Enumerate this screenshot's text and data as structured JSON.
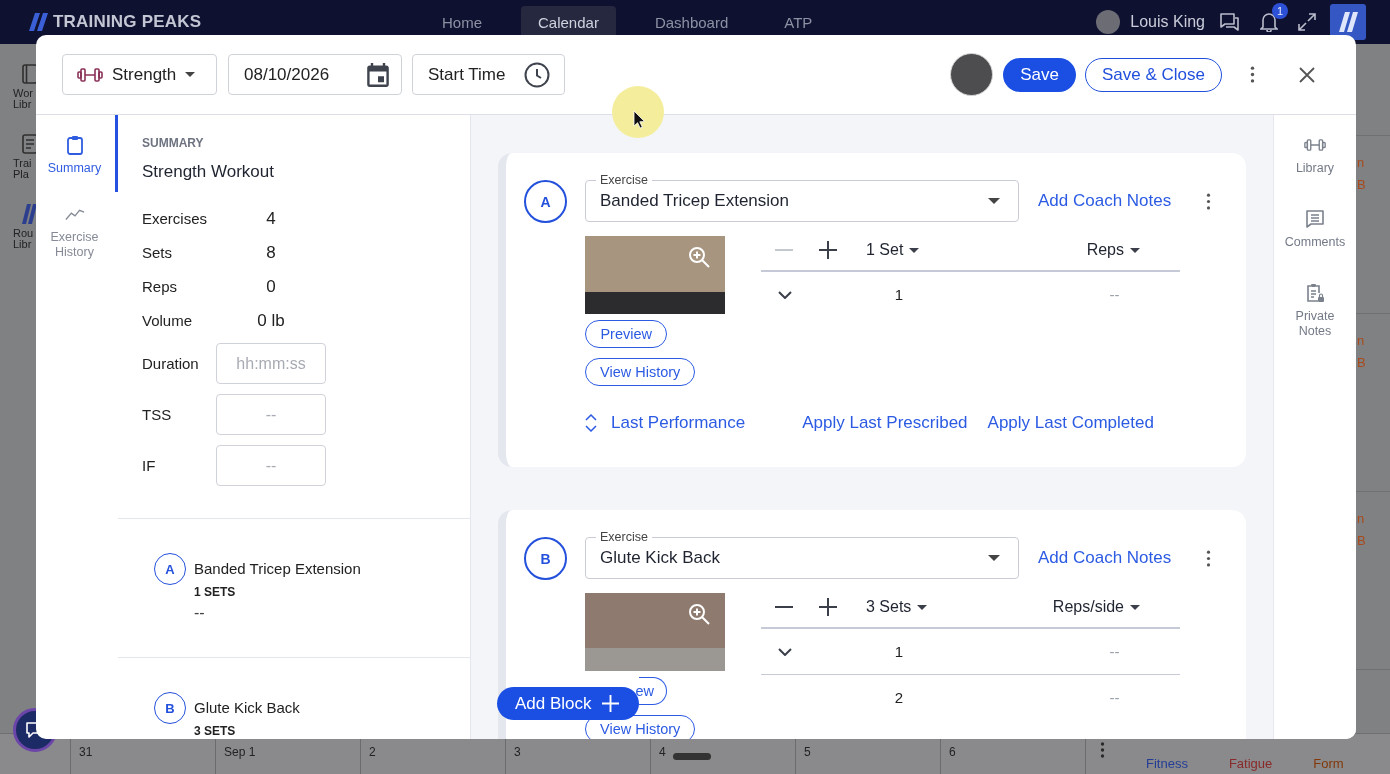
{
  "top_nav": {
    "logo": "TRAINING PEAKS",
    "items": [
      {
        "label": "Home",
        "selected": false
      },
      {
        "label": "Calendar",
        "selected": true
      },
      {
        "label": "Dashboard",
        "selected": false
      },
      {
        "label": "ATP",
        "selected": false
      }
    ],
    "user_name": "Louis King",
    "notification_count": "1"
  },
  "background_sidebar": [
    {
      "lines": [
        "Wor",
        "Libr"
      ]
    },
    {
      "lines": [
        "Trai",
        "Pla"
      ]
    },
    {
      "lines": [
        "Rou",
        "Libr"
      ]
    }
  ],
  "calendar_edge_entries": [
    {
      "lines": [
        "n",
        "B"
      ]
    },
    {
      "lines": [
        "n",
        "B"
      ]
    },
    {
      "lines": [
        "n",
        "B"
      ]
    }
  ],
  "workout_modal": {
    "header": {
      "workout_type": "Strength",
      "date": "08/10/2026",
      "start_time": "Start Time",
      "save": "Save",
      "save_and_close": "Save & Close"
    },
    "side_tabs": [
      {
        "label": "Summary",
        "selected": true
      },
      {
        "label": "Exercise History",
        "selected": false
      }
    ],
    "summary": {
      "heading": "SUMMARY",
      "title": "Strength Workout",
      "stats": [
        {
          "label": "Exercises",
          "value": "4"
        },
        {
          "label": "Sets",
          "value": "8"
        },
        {
          "label": "Reps",
          "value": "0"
        },
        {
          "label": "Volume",
          "value": "0 lb"
        }
      ],
      "fields": [
        {
          "label": "Duration",
          "placeholder": "hh:mm:ss"
        },
        {
          "label": "TSS",
          "placeholder": "--"
        },
        {
          "label": "IF",
          "placeholder": "--"
        }
      ],
      "exercises": [
        {
          "letter": "A",
          "name": "Banded Tricep Extension",
          "sets": "1 SETS",
          "detail": "--"
        },
        {
          "letter": "B",
          "name": "Glute Kick Back",
          "sets": "3 SETS"
        }
      ]
    },
    "blocks": [
      {
        "letter": "A",
        "exercise_label": "Exercise",
        "exercise": "Banded Tricep Extension",
        "coach_notes": "Add Coach Notes",
        "preview": "Preview",
        "view_history": "View History",
        "remove_set_disabled": true,
        "sets": "1 Set",
        "metric": "Reps",
        "rows": [
          {
            "number": "1",
            "value": "--",
            "collapsible": true
          }
        ],
        "footer": {
          "last_performance": "Last Performance",
          "apply_prescribed": "Apply Last Prescribed",
          "apply_completed": "Apply Last Completed"
        }
      },
      {
        "letter": "B",
        "exercise_label": "Exercise",
        "exercise": "Glute Kick Back",
        "coach_notes": "Add Coach Notes",
        "preview": "ew",
        "view_history": "View History",
        "remove_set_disabled": false,
        "sets": "3 Sets",
        "metric": "Reps/side",
        "rows": [
          {
            "number": "1",
            "value": "--",
            "collapsible": true
          },
          {
            "number": "2",
            "value": "--",
            "collapsible": false
          }
        ]
      }
    ],
    "add_block": "Add Block",
    "right_rail": [
      "Library",
      "Comments",
      "Private Notes"
    ]
  },
  "calendar_week": {
    "days": [
      "31",
      "Sep 1",
      "2",
      "3",
      "4",
      "5",
      "6"
    ],
    "legend": [
      {
        "label": "Fitness",
        "color": "#233d96"
      },
      {
        "label": "Fatigue",
        "color": "#8a2a2a"
      },
      {
        "label": "Form",
        "color": "#833808"
      }
    ]
  }
}
